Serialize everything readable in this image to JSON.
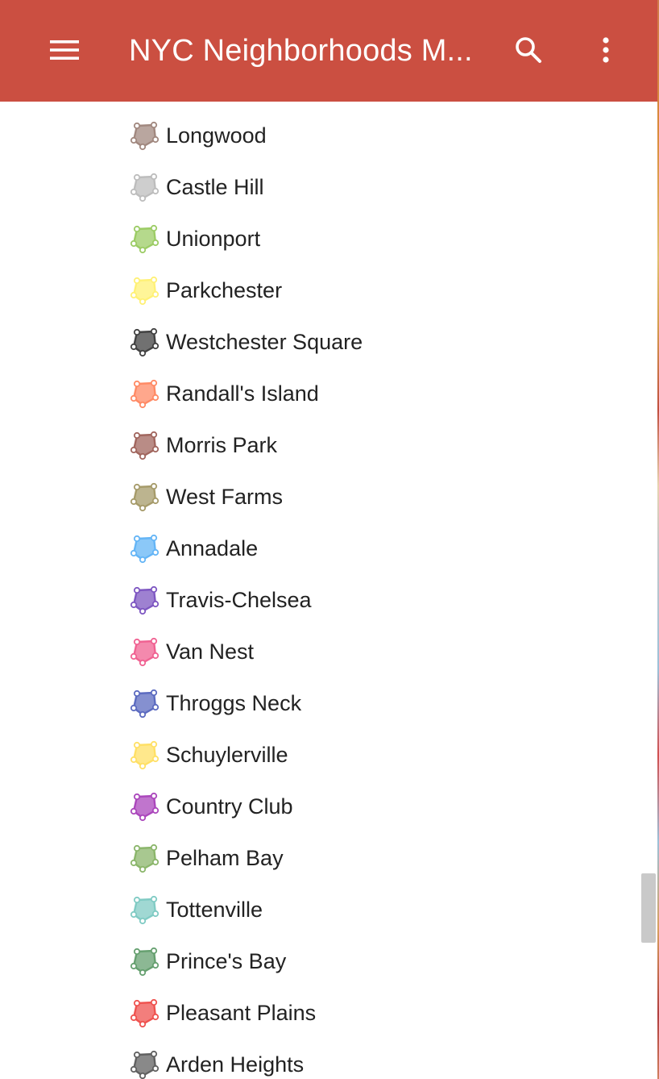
{
  "app_bar": {
    "title": "NYC Neighborhoods M...",
    "background": "#cb4f41"
  },
  "icons": {
    "menu": "menu-icon",
    "search": "search-icon",
    "more": "more-vert-icon",
    "item": "polygon-icon"
  },
  "neighborhoods": [
    {
      "name": "Longwood",
      "color": "#a1887f"
    },
    {
      "name": "Castle Hill",
      "color": "#bdbdbd"
    },
    {
      "name": "Unionport",
      "color": "#9ccc65"
    },
    {
      "name": "Parkchester",
      "color": "#fff176"
    },
    {
      "name": "Westchester Square",
      "color": "#424242"
    },
    {
      "name": "Randall's Island",
      "color": "#ff8a65"
    },
    {
      "name": "Morris Park",
      "color": "#a1665e"
    },
    {
      "name": "West Farms",
      "color": "#a69b6a"
    },
    {
      "name": "Annadale",
      "color": "#64b5f6"
    },
    {
      "name": "Travis-Chelsea",
      "color": "#7e57c2"
    },
    {
      "name": "Van Nest",
      "color": "#f06292"
    },
    {
      "name": "Throggs Neck",
      "color": "#5c6bc0"
    },
    {
      "name": "Schuylerville",
      "color": "#ffe066"
    },
    {
      "name": "Country Club",
      "color": "#ab47bc"
    },
    {
      "name": "Pelham Bay",
      "color": "#8bb66b"
    },
    {
      "name": "Tottenville",
      "color": "#80cbc4"
    },
    {
      "name": "Prince's Bay",
      "color": "#66a070"
    },
    {
      "name": "Pleasant Plains",
      "color": "#ef5350"
    },
    {
      "name": "Arden Heights",
      "color": "#616161"
    }
  ]
}
